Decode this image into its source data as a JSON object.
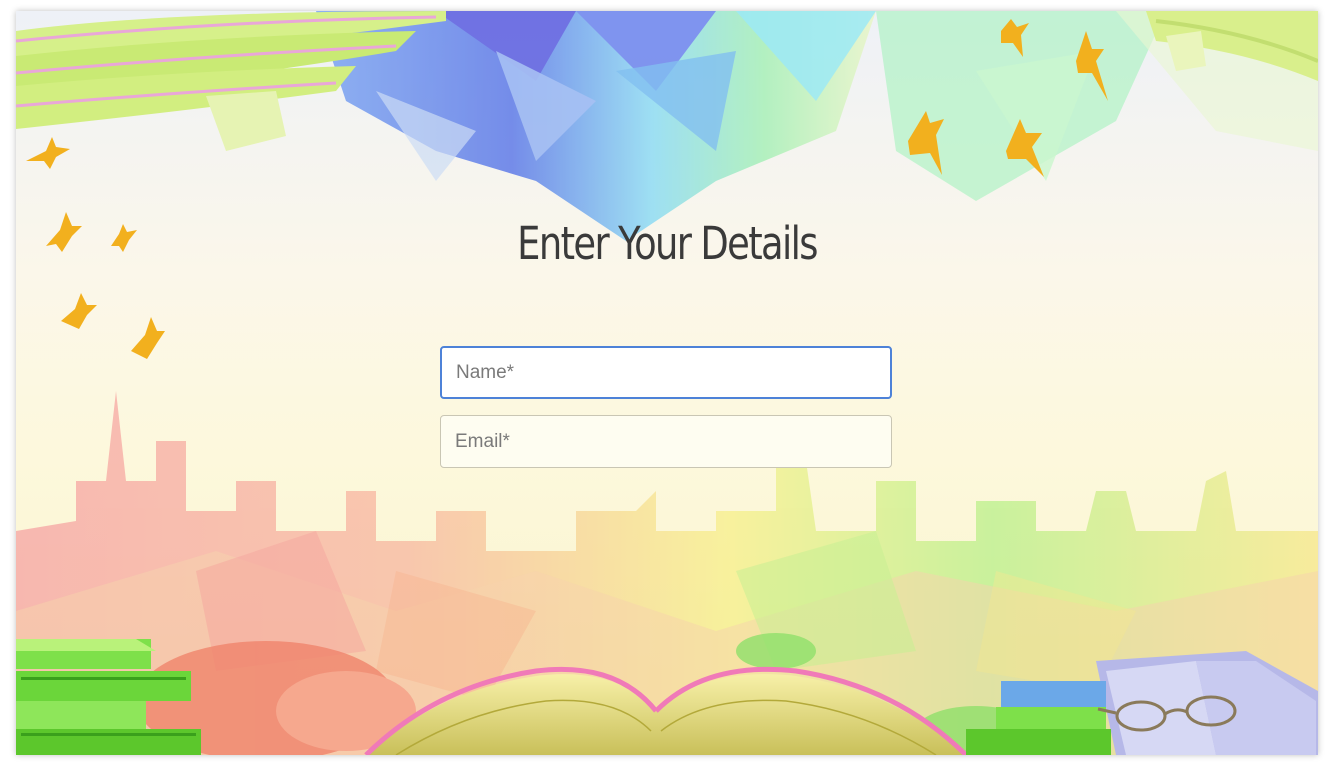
{
  "page": {
    "title": "Enter Your Details"
  },
  "form": {
    "name_placeholder": "Name*",
    "name_value": "",
    "email_placeholder": "Email*",
    "email_value": ""
  },
  "colors": {
    "focus_border": "#4d82d8",
    "title_text": "#3a3a3a",
    "bird": "#f2b01e"
  },
  "decor": {
    "icons": [
      "rope-decoration",
      "bird-icon",
      "book-stack-icon",
      "open-book-icon",
      "glasses-icon",
      "city-skyline"
    ]
  }
}
